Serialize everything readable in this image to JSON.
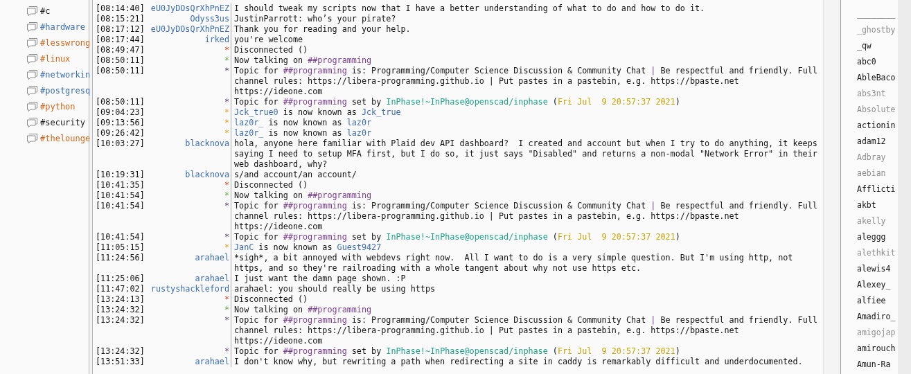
{
  "channels": [
    {
      "name": "#c",
      "color": "#1a1a1a"
    },
    {
      "name": "#hardware",
      "color": "#3b6db3"
    },
    {
      "name": "#lesswrong",
      "color": "#d2671b"
    },
    {
      "name": "#linux",
      "color": "#d2671b"
    },
    {
      "name": "#networkin",
      "color": "#3b6db3"
    },
    {
      "name": "#postgresq",
      "color": "#3b6db3"
    },
    {
      "name": "#python",
      "color": "#d2671b"
    },
    {
      "name": "#security",
      "color": "#1a1a1a"
    },
    {
      "name": "#thelounge",
      "color": "#d2671b"
    }
  ],
  "chat": [
    {
      "time": "[08:14:40]",
      "nick": "eU0JyDOsQrXhPnEZ",
      "kind": "message",
      "parts": [
        {
          "text": "I should tweak my scripts now that I have a better understanding of what to do and how to do it.",
          "kind": "plain"
        }
      ]
    },
    {
      "time": "[08:15:21]",
      "nick": "Odyss3us",
      "kind": "message",
      "parts": [
        {
          "text": "JustinParrott: who’s your pirate?",
          "kind": "plain"
        }
      ]
    },
    {
      "time": "[08:17:12]",
      "nick": "eU0JyDOsQrXhPnEZ",
      "kind": "message",
      "parts": [
        {
          "text": "Thank you for reading and your help.",
          "kind": "plain"
        }
      ]
    },
    {
      "time": "[08:17:44]",
      "nick": "irked",
      "kind": "message",
      "parts": [
        {
          "text": "you're welcome",
          "kind": "plain"
        }
      ]
    },
    {
      "time": "[08:49:47]",
      "nick": "*",
      "kind": "disconnect",
      "parts": [
        {
          "text": "Disconnected ()",
          "kind": "plain"
        }
      ]
    },
    {
      "time": "[08:50:11]",
      "nick": "*",
      "kind": "join",
      "parts": [
        {
          "text": "Now talking on ",
          "kind": "plain"
        },
        {
          "text": "##programming",
          "kind": "channel"
        }
      ]
    },
    {
      "time": "[08:50:11]",
      "nick": "*",
      "kind": "topic",
      "parts": [
        {
          "text": "Topic for ",
          "kind": "plain"
        },
        {
          "text": "##programming",
          "kind": "channel"
        },
        {
          "text": " is: Programming/Computer Science Discussion & Community Chat ",
          "kind": "plain"
        },
        {
          "text": "|",
          "kind": "channel"
        },
        {
          "text": " Be respectful and friendly. Full channel rules: https://libera-programming.github.io | Put pastes in a pastebin, e.g. https://bpaste.net https://ideone.com",
          "kind": "plain"
        }
      ]
    },
    {
      "time": "[08:50:11]",
      "nick": "*",
      "kind": "topic",
      "parts": [
        {
          "text": "Topic for ",
          "kind": "plain"
        },
        {
          "text": "##programming",
          "kind": "channel"
        },
        {
          "text": " set by ",
          "kind": "plain"
        },
        {
          "text": "InPhase!~InPhase@openscad/inphase",
          "kind": "host"
        },
        {
          "text": " (",
          "kind": "plain"
        },
        {
          "text": "Fri Jul  9 20:57:37 2021",
          "kind": "date"
        },
        {
          "text": ")",
          "kind": "plain"
        }
      ]
    },
    {
      "time": "[09:04:23]",
      "nick": "*",
      "kind": "nick_change",
      "parts": [
        {
          "text": "Jck_true0",
          "kind": "nick"
        },
        {
          "text": " is now known as ",
          "kind": "plain"
        },
        {
          "text": "Jck_true",
          "kind": "nick"
        }
      ]
    },
    {
      "time": "[09:13:56]",
      "nick": "*",
      "kind": "nick_change",
      "parts": [
        {
          "text": "laz0r_",
          "kind": "nick"
        },
        {
          "text": " is now known as ",
          "kind": "plain"
        },
        {
          "text": "laz0r",
          "kind": "nick"
        }
      ]
    },
    {
      "time": "[09:26:42]",
      "nick": "*",
      "kind": "nick_change",
      "parts": [
        {
          "text": "laz0r_",
          "kind": "nick"
        },
        {
          "text": " is now known as ",
          "kind": "plain"
        },
        {
          "text": "laz0r",
          "kind": "nick"
        }
      ]
    },
    {
      "time": "[10:03:27]",
      "nick": "blacknova",
      "kind": "message",
      "parts": [
        {
          "text": "hola, anyone here familiar with Plaid dev API dashboard?  I created and account but when I try to do anything, it keeps saying I need to setup MFA first, but I do so, it just says \"Disabled\" and returns a non-modal \"Network Error\" in their web dashboard, why?",
          "kind": "plain"
        }
      ]
    },
    {
      "time": "[10:19:31]",
      "nick": "blacknova",
      "kind": "message",
      "parts": [
        {
          "text": "s/and account/an account/",
          "kind": "plain"
        }
      ]
    },
    {
      "time": "[10:41:35]",
      "nick": "*",
      "kind": "disconnect",
      "parts": [
        {
          "text": "Disconnected ()",
          "kind": "plain"
        }
      ]
    },
    {
      "time": "[10:41:54]",
      "nick": "*",
      "kind": "join",
      "parts": [
        {
          "text": "Now talking on ",
          "kind": "plain"
        },
        {
          "text": "##programming",
          "kind": "channel"
        }
      ]
    },
    {
      "time": "[10:41:54]",
      "nick": "*",
      "kind": "topic",
      "parts": [
        {
          "text": "Topic for ",
          "kind": "plain"
        },
        {
          "text": "##programming",
          "kind": "channel"
        },
        {
          "text": " is: Programming/Computer Science Discussion & Community Chat ",
          "kind": "plain"
        },
        {
          "text": "|",
          "kind": "channel"
        },
        {
          "text": " Be respectful and friendly. Full channel rules: https://libera-programming.github.io | Put pastes in a pastebin, e.g. https://bpaste.net https://ideone.com",
          "kind": "plain"
        }
      ]
    },
    {
      "time": "[10:41:54]",
      "nick": "*",
      "kind": "topic",
      "parts": [
        {
          "text": "Topic for ",
          "kind": "plain"
        },
        {
          "text": "##programming",
          "kind": "channel"
        },
        {
          "text": " set by ",
          "kind": "plain"
        },
        {
          "text": "InPhase!~InPhase@openscad/inphase",
          "kind": "host"
        },
        {
          "text": " (",
          "kind": "plain"
        },
        {
          "text": "Fri Jul  9 20:57:37 2021",
          "kind": "date"
        },
        {
          "text": ")",
          "kind": "plain"
        }
      ]
    },
    {
      "time": "[11:05:15]",
      "nick": "*",
      "kind": "nick_change",
      "parts": [
        {
          "text": "JanC",
          "kind": "nick"
        },
        {
          "text": " is now known as ",
          "kind": "plain"
        },
        {
          "text": "Guest9427",
          "kind": "nick"
        }
      ]
    },
    {
      "time": "[11:24:56]",
      "nick": "arahael",
      "kind": "message",
      "parts": [
        {
          "text": "*sigh*, a bit annoyed with webdevs right now.  All I want to do is a very simple question. But I'm using http, not https, and so they're railroading with a whole tangent about why not use https etc.",
          "kind": "plain"
        }
      ]
    },
    {
      "time": "[11:25:06]",
      "nick": "arahael",
      "kind": "message",
      "parts": [
        {
          "text": "I just want the damn page shown. :P",
          "kind": "plain"
        }
      ]
    },
    {
      "time": "[11:47:02]",
      "nick": "rustyshackleford",
      "kind": "message",
      "parts": [
        {
          "text": "arahael: you should really be using https",
          "kind": "plain"
        }
      ]
    },
    {
      "time": "[13:24:13]",
      "nick": "*",
      "kind": "disconnect",
      "parts": [
        {
          "text": "Disconnected ()",
          "kind": "plain"
        }
      ]
    },
    {
      "time": "[13:24:32]",
      "nick": "*",
      "kind": "join",
      "parts": [
        {
          "text": "Now talking on ",
          "kind": "plain"
        },
        {
          "text": "##programming",
          "kind": "channel"
        }
      ]
    },
    {
      "time": "[13:24:32]",
      "nick": "*",
      "kind": "topic",
      "parts": [
        {
          "text": "Topic for ",
          "kind": "plain"
        },
        {
          "text": "##programming",
          "kind": "channel"
        },
        {
          "text": " is: Programming/Computer Science Discussion & Community Chat ",
          "kind": "plain"
        },
        {
          "text": "|",
          "kind": "channel"
        },
        {
          "text": " Be respectful and friendly. Full channel rules: https://libera-programming.github.io | Put pastes in a pastebin, e.g. https://bpaste.net https://ideone.com",
          "kind": "plain"
        }
      ]
    },
    {
      "time": "[13:24:32]",
      "nick": "*",
      "kind": "topic",
      "parts": [
        {
          "text": "Topic for ",
          "kind": "plain"
        },
        {
          "text": "##programming",
          "kind": "channel"
        },
        {
          "text": " set by ",
          "kind": "plain"
        },
        {
          "text": "InPhase!~InPhase@openscad/inphase",
          "kind": "host"
        },
        {
          "text": " (",
          "kind": "plain"
        },
        {
          "text": "Fri Jul  9 20:57:37 2021",
          "kind": "date"
        },
        {
          "text": ")",
          "kind": "plain"
        }
      ]
    },
    {
      "time": "[13:51:33]",
      "nick": "arahael",
      "kind": "message",
      "parts": [
        {
          "text": "I don't know why, but rewriting a path when redirecting a site in caddy is remarkably difficult and underdocumented.",
          "kind": "plain"
        }
      ]
    }
  ],
  "users": [
    {
      "nick": "________",
      "away": false
    },
    {
      "nick": "_ghostby",
      "away": true
    },
    {
      "nick": "_qw",
      "away": false
    },
    {
      "nick": "abc0",
      "away": false
    },
    {
      "nick": "AbleBaco",
      "away": false
    },
    {
      "nick": "abs3nt",
      "away": true
    },
    {
      "nick": "Absolute",
      "away": true
    },
    {
      "nick": "actionin",
      "away": false
    },
    {
      "nick": "adam12",
      "away": false
    },
    {
      "nick": "Adbray",
      "away": true
    },
    {
      "nick": "aebian",
      "away": true
    },
    {
      "nick": "Afflicti",
      "away": false
    },
    {
      "nick": "akbt",
      "away": false
    },
    {
      "nick": "akelly",
      "away": true
    },
    {
      "nick": "aleggg",
      "away": false
    },
    {
      "nick": "alethkit",
      "away": true
    },
    {
      "nick": "alewis4",
      "away": false
    },
    {
      "nick": "Alexey_",
      "away": false
    },
    {
      "nick": "alfiee",
      "away": false
    },
    {
      "nick": "Amadiro_",
      "away": false
    },
    {
      "nick": "amigojap",
      "away": true
    },
    {
      "nick": "amirouch",
      "away": false
    },
    {
      "nick": "Amun-Ra",
      "away": false
    }
  ]
}
